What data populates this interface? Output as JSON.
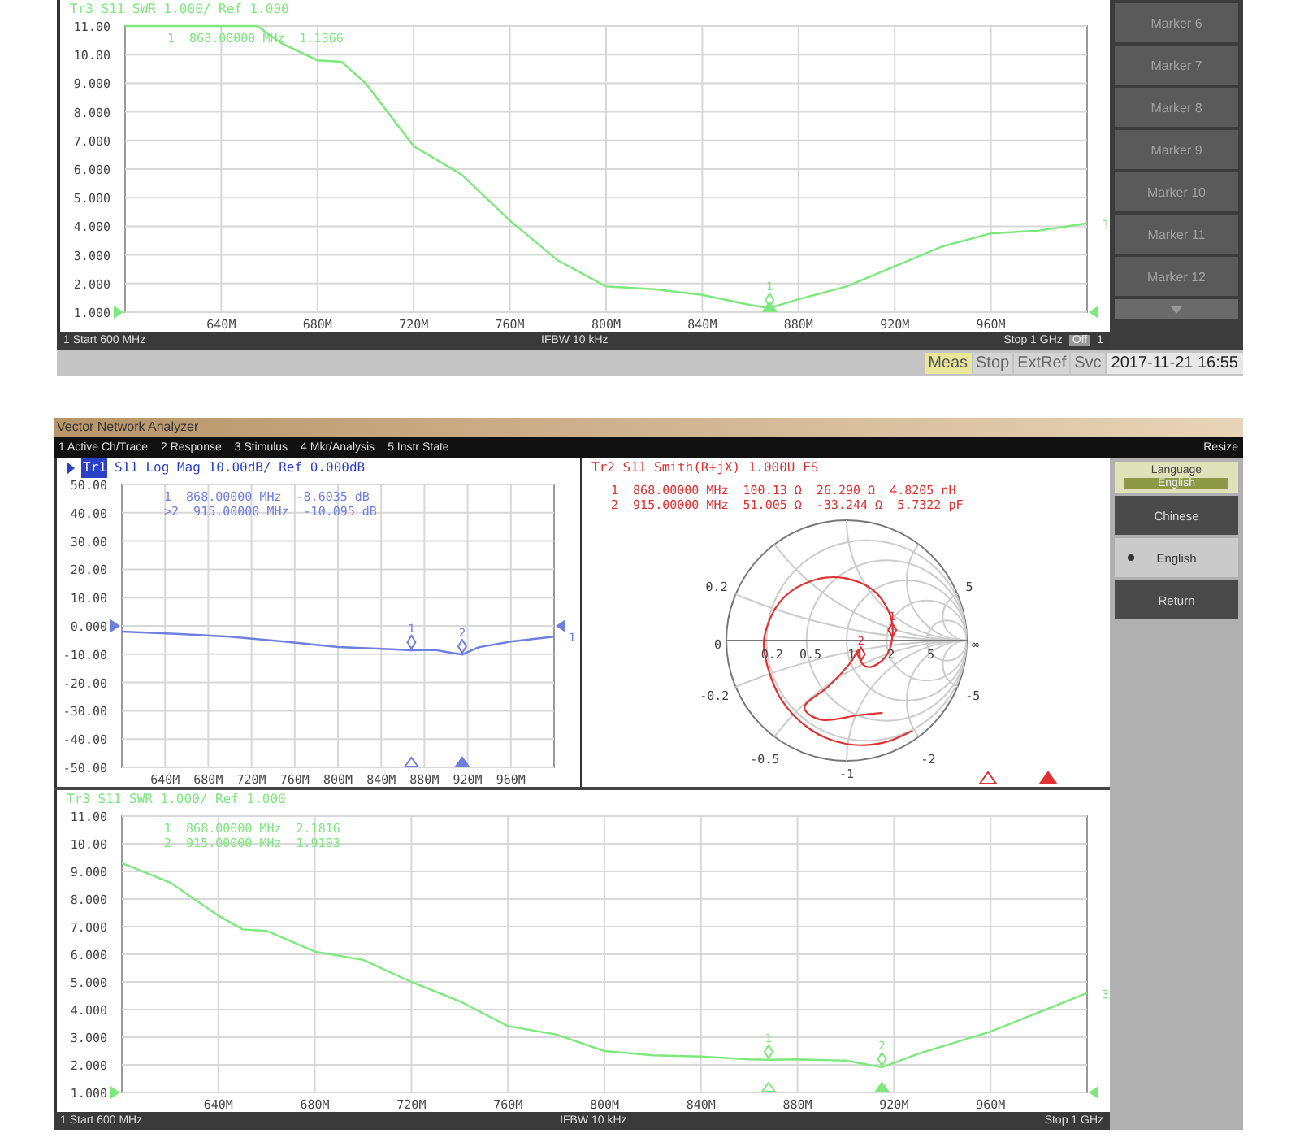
{
  "top_window": {
    "swr_chart": {
      "header": "Tr3 S11 SWR 1.000/ Ref 1.000",
      "readouts": [
        "1  868.00000 MHz  1.1366"
      ],
      "trace_number": "3",
      "chart_data": {
        "type": "line",
        "xlim": [
          600,
          1000
        ],
        "ylim": [
          1,
          11
        ],
        "xticks": [
          {
            "value": 640,
            "label": "640M"
          },
          {
            "value": 680,
            "label": "680M"
          },
          {
            "value": 720,
            "label": "720M"
          },
          {
            "value": 760,
            "label": "760M"
          },
          {
            "value": 800,
            "label": "800M"
          },
          {
            "value": 840,
            "label": "840M"
          },
          {
            "value": 880,
            "label": "880M"
          },
          {
            "value": 920,
            "label": "920M"
          },
          {
            "value": 960,
            "label": "960M"
          }
        ],
        "yticks": [
          {
            "value": 11,
            "label": "11.00"
          },
          {
            "value": 10,
            "label": "10.00"
          },
          {
            "value": 9,
            "label": "9.000"
          },
          {
            "value": 8,
            "label": "8.000"
          },
          {
            "value": 7,
            "label": "7.000"
          },
          {
            "value": 6,
            "label": "6.000"
          },
          {
            "value": 5,
            "label": "5.000"
          },
          {
            "value": 4,
            "label": "4.000"
          },
          {
            "value": 3,
            "label": "3.000"
          },
          {
            "value": 2,
            "label": "2.000"
          },
          {
            "value": 1,
            "label": "1.000"
          }
        ],
        "x": [
          600,
          620,
          640,
          655,
          665,
          680,
          690,
          700,
          720,
          740,
          760,
          780,
          800,
          820,
          840,
          860,
          868,
          880,
          900,
          920,
          940,
          960,
          980,
          1000
        ],
        "series": [
          {
            "color": "#7de87d",
            "values": [
              11,
              11,
              11,
              11,
              10.4,
              9.8,
              9.75,
              9.0,
              6.8,
              5.8,
              4.2,
              2.8,
              1.9,
              1.8,
              1.6,
              1.25,
              1.14,
              1.45,
              1.9,
              2.6,
              3.3,
              3.75,
              3.85,
              4.1
            ]
          }
        ],
        "grid": true
      },
      "markers": [
        {
          "label": "1",
          "selected": true
        }
      ]
    },
    "marker_buttons": [
      "Marker 6",
      "Marker 7",
      "Marker 8",
      "Marker 9",
      "Marker 10",
      "Marker 11",
      "Marker 12"
    ],
    "status_bar": {
      "start": "1 Start 600 MHz",
      "ifbw": "IFBW 10 kHz",
      "stop": "Stop 1 GHz",
      "off": "Off",
      "channel": "1"
    },
    "indicators": [
      {
        "label": "Meas",
        "on": true
      },
      {
        "label": "Stop",
        "on": false
      },
      {
        "label": "ExtRef",
        "on": false
      },
      {
        "label": "Svc",
        "on": false
      }
    ],
    "datetime": "2017-11-21 16:55"
  },
  "analyzer_window": {
    "title": "Vector Network Analyzer",
    "menu": [
      "1 Active Ch/Trace",
      "2 Response",
      "3 Stimulus",
      "4 Mkr/Analysis",
      "5 Instr State"
    ],
    "resize": "Resize",
    "log_mag_chart": {
      "trace_tag": "Tr1",
      "header": "S11 Log Mag 10.00dB/ Ref 0.000dB",
      "readouts": [
        "1  868.00000 MHz  -8.6035 dB",
        ">2  915.00000 MHz  -10.095 dB"
      ],
      "trace_number": "1",
      "chart_data": {
        "type": "line",
        "xlim": [
          600,
          1000
        ],
        "ylim": [
          -50,
          50
        ],
        "xticks": [
          {
            "value": 640,
            "label": "640M"
          },
          {
            "value": 680,
            "label": "680M"
          },
          {
            "value": 720,
            "label": "720M"
          },
          {
            "value": 760,
            "label": "760M"
          },
          {
            "value": 800,
            "label": "800M"
          },
          {
            "value": 840,
            "label": "840M"
          },
          {
            "value": 880,
            "label": "880M"
          },
          {
            "value": 920,
            "label": "920M"
          },
          {
            "value": 960,
            "label": "960M"
          }
        ],
        "yticks": [
          {
            "value": 50,
            "label": "50.00"
          },
          {
            "value": 40,
            "label": "40.00"
          },
          {
            "value": 30,
            "label": "30.00"
          },
          {
            "value": 20,
            "label": "20.00"
          },
          {
            "value": 10,
            "label": "10.00"
          },
          {
            "value": 0,
            "label": "0.000"
          },
          {
            "value": -10,
            "label": "-10.00"
          },
          {
            "value": -20,
            "label": "-20.00"
          },
          {
            "value": -30,
            "label": "-30.00"
          },
          {
            "value": -40,
            "label": "-40.00"
          },
          {
            "value": -50,
            "label": "-50.00"
          }
        ],
        "x": [
          600,
          650,
          700,
          750,
          800,
          850,
          868,
          890,
          900,
          915,
          930,
          960,
          1000
        ],
        "series": [
          {
            "color": "#6f7fe0",
            "values": [
              -2,
              -2.8,
              -3.8,
              -5.5,
              -7.5,
              -8.3,
              -8.6,
              -8.5,
              -9.2,
              -10.1,
              -7.6,
              -5.5,
              -3.8
            ]
          }
        ],
        "grid": true
      },
      "markers": [
        {
          "label": "1",
          "selected": false
        },
        {
          "label": "2",
          "selected": true
        }
      ]
    },
    "smith_chart": {
      "header": "Tr2 S11 Smith(R+jX) 1.000U FS",
      "readouts": [
        "1  868.00000 MHz  100.13 Ω  26.290 Ω  4.8205 nH",
        "2  915.00000 MHz  51.005 Ω  -33.244 Ω  5.7322 pF"
      ],
      "scale_labels": [
        "0.2",
        "5",
        "-0.2",
        "-5",
        "-0.5",
        "-1",
        "-2",
        "0",
        "0.2",
        "0.5",
        "1",
        "2",
        "5",
        "∞"
      ],
      "trace_markers": [
        "1",
        "2"
      ],
      "markers": [
        {
          "selected": false
        },
        {
          "selected": true
        }
      ]
    },
    "swr_chart": {
      "header": "Tr3 S11 SWR 1.000/ Ref 1.000",
      "readouts": [
        "1  868.00000 MHz  2.1816",
        "2  915.00000 MHz  1.9103"
      ],
      "trace_number": "3",
      "chart_data": {
        "type": "line",
        "xlim": [
          600,
          1000
        ],
        "ylim": [
          1,
          11
        ],
        "xticks": [
          {
            "value": 640,
            "label": "640M"
          },
          {
            "value": 680,
            "label": "680M"
          },
          {
            "value": 720,
            "label": "720M"
          },
          {
            "value": 760,
            "label": "760M"
          },
          {
            "value": 800,
            "label": "800M"
          },
          {
            "value": 840,
            "label": "840M"
          },
          {
            "value": 880,
            "label": "880M"
          },
          {
            "value": 920,
            "label": "920M"
          },
          {
            "value": 960,
            "label": "960M"
          }
        ],
        "yticks": [
          {
            "value": 11,
            "label": "11.00"
          },
          {
            "value": 10,
            "label": "10.00"
          },
          {
            "value": 9,
            "label": "9.000"
          },
          {
            "value": 8,
            "label": "8.000"
          },
          {
            "value": 7,
            "label": "7.000"
          },
          {
            "value": 6,
            "label": "6.000"
          },
          {
            "value": 5,
            "label": "5.000"
          },
          {
            "value": 4,
            "label": "4.000"
          },
          {
            "value": 3,
            "label": "3.000"
          },
          {
            "value": 2,
            "label": "2.000"
          },
          {
            "value": 1,
            "label": "1.000"
          }
        ],
        "x": [
          600,
          620,
          640,
          650,
          660,
          680,
          700,
          720,
          740,
          760,
          780,
          800,
          820,
          840,
          860,
          868,
          880,
          900,
          915,
          930,
          960,
          1000
        ],
        "series": [
          {
            "color": "#7de87d",
            "values": [
              9.3,
              8.6,
              7.4,
              6.9,
              6.85,
              6.1,
              5.8,
              5.0,
              4.3,
              3.4,
              3.1,
              2.5,
              2.35,
              2.3,
              2.2,
              2.18,
              2.2,
              2.15,
              1.91,
              2.4,
              3.2,
              4.6
            ]
          }
        ],
        "grid": true
      },
      "markers": [
        {
          "label": "1",
          "selected": false
        },
        {
          "label": "2",
          "selected": true
        }
      ]
    },
    "status_bar": {
      "start": "1 Start 600 MHz",
      "ifbw": "IFBW 10 kHz",
      "stop": "Stop 1 GHz"
    },
    "language_panel": {
      "title": "Language",
      "value": "English",
      "options": [
        {
          "label": "Chinese",
          "selected": false
        },
        {
          "label": "English",
          "selected": true
        }
      ],
      "return_button": "Return"
    }
  }
}
